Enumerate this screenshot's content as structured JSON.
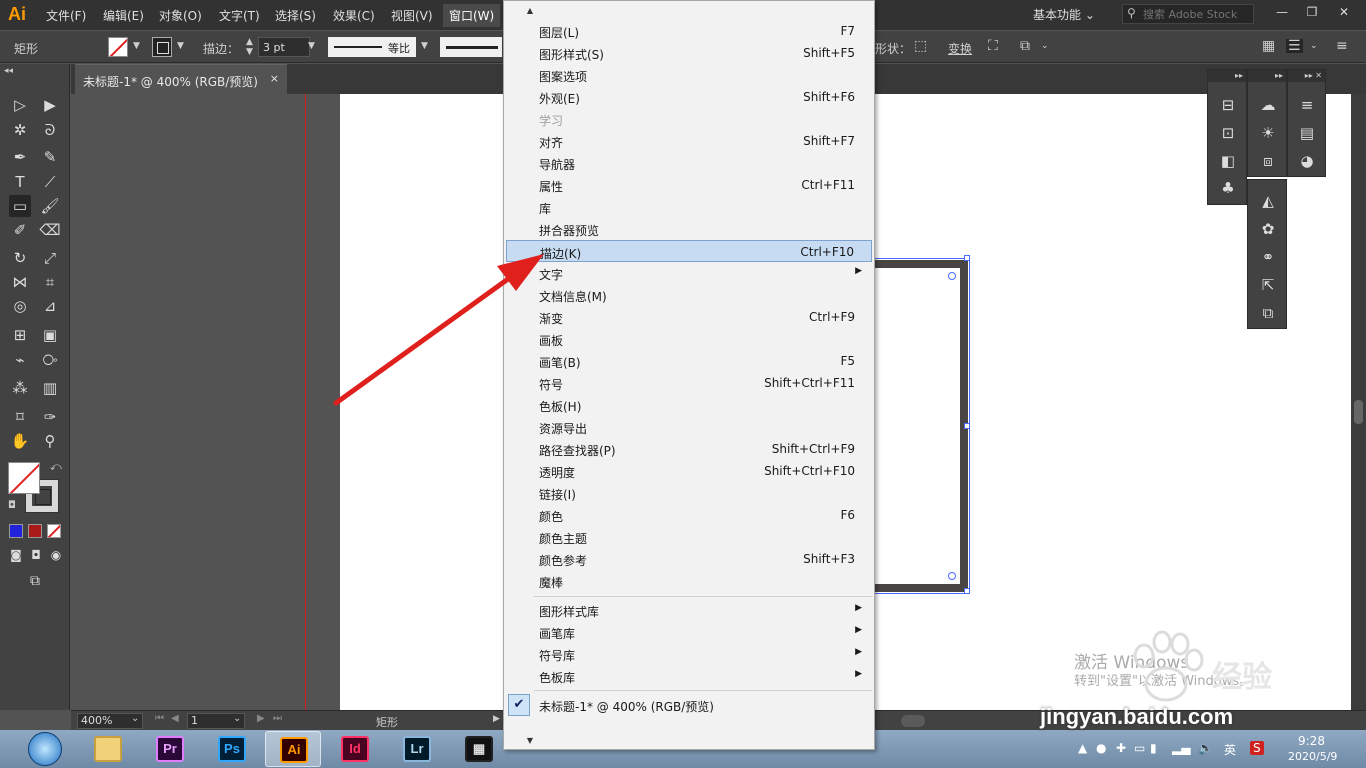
{
  "app": {
    "logo": "Ai"
  },
  "menubar": {
    "items": [
      "文件(F)",
      "编辑(E)",
      "对象(O)",
      "文字(T)",
      "选择(S)",
      "效果(C)",
      "视图(V)",
      "窗口(W)"
    ],
    "workspace": "基本功能",
    "search_placeholder": "搜索 Adobe Stock"
  },
  "controlbar": {
    "tool_name": "矩形",
    "stroke_label": "描边：",
    "stroke_weight": "3 pt",
    "profile": "等比",
    "shape_label": "形状：",
    "transform_label": "变换"
  },
  "document": {
    "tab_title": "未标题-1* @ 400% (RGB/预览)",
    "tab_close": "×"
  },
  "window_menu": {
    "items": [
      {
        "label": "图层(L)",
        "shortcut": "F7"
      },
      {
        "label": "图形样式(S)",
        "shortcut": "Shift+F5"
      },
      {
        "label": "图案选项",
        "shortcut": ""
      },
      {
        "label": "外观(E)",
        "shortcut": "Shift+F6"
      },
      {
        "label": "学习",
        "shortcut": ""
      },
      {
        "label": "对齐",
        "shortcut": "Shift+F7"
      },
      {
        "label": "导航器",
        "shortcut": ""
      },
      {
        "label": "属性",
        "shortcut": "Ctrl+F11"
      },
      {
        "label": "库",
        "shortcut": ""
      },
      {
        "label": "拼合器预览",
        "shortcut": ""
      },
      {
        "label": "描边(K)",
        "shortcut": "Ctrl+F10"
      },
      {
        "label": "文字",
        "shortcut": ""
      },
      {
        "label": "文档信息(M)",
        "shortcut": ""
      },
      {
        "label": "渐变",
        "shortcut": "Ctrl+F9"
      },
      {
        "label": "画板",
        "shortcut": ""
      },
      {
        "label": "画笔(B)",
        "shortcut": "F5"
      },
      {
        "label": "符号",
        "shortcut": "Shift+Ctrl+F11"
      },
      {
        "label": "色板(H)",
        "shortcut": ""
      },
      {
        "label": "资源导出",
        "shortcut": ""
      },
      {
        "label": "路径查找器(P)",
        "shortcut": "Shift+Ctrl+F9"
      },
      {
        "label": "透明度",
        "shortcut": "Shift+Ctrl+F10"
      },
      {
        "label": "链接(I)",
        "shortcut": ""
      },
      {
        "label": "颜色",
        "shortcut": "F6"
      },
      {
        "label": "颜色主题",
        "shortcut": ""
      },
      {
        "label": "颜色参考",
        "shortcut": "Shift+F3"
      },
      {
        "label": "魔棒",
        "shortcut": ""
      }
    ],
    "libraries": [
      "图形样式库",
      "画笔库",
      "符号库",
      "色板库"
    ],
    "open_document": "未标题-1* @ 400% (RGB/预览)"
  },
  "statusbar": {
    "zoom": "400%",
    "artboard": "1",
    "tool": "矩形"
  },
  "watermark": {
    "line1": "激活 Windows",
    "line2": "转到\"设置\"以激活 Windows。",
    "site": "jingyan.baidu.com",
    "brand": "经验"
  },
  "taskbar": {
    "apps": [
      "Pr",
      "Ps",
      "Ai",
      "Id",
      "Lr"
    ],
    "ime": "英",
    "time": "9:28",
    "date": "2020/5/9"
  },
  "colors": {
    "accent_ai": "#ff9a00",
    "arrow": "#e0201c",
    "menu_highlight": "#c7dcf2",
    "bleed_line": "#d01c1c"
  }
}
